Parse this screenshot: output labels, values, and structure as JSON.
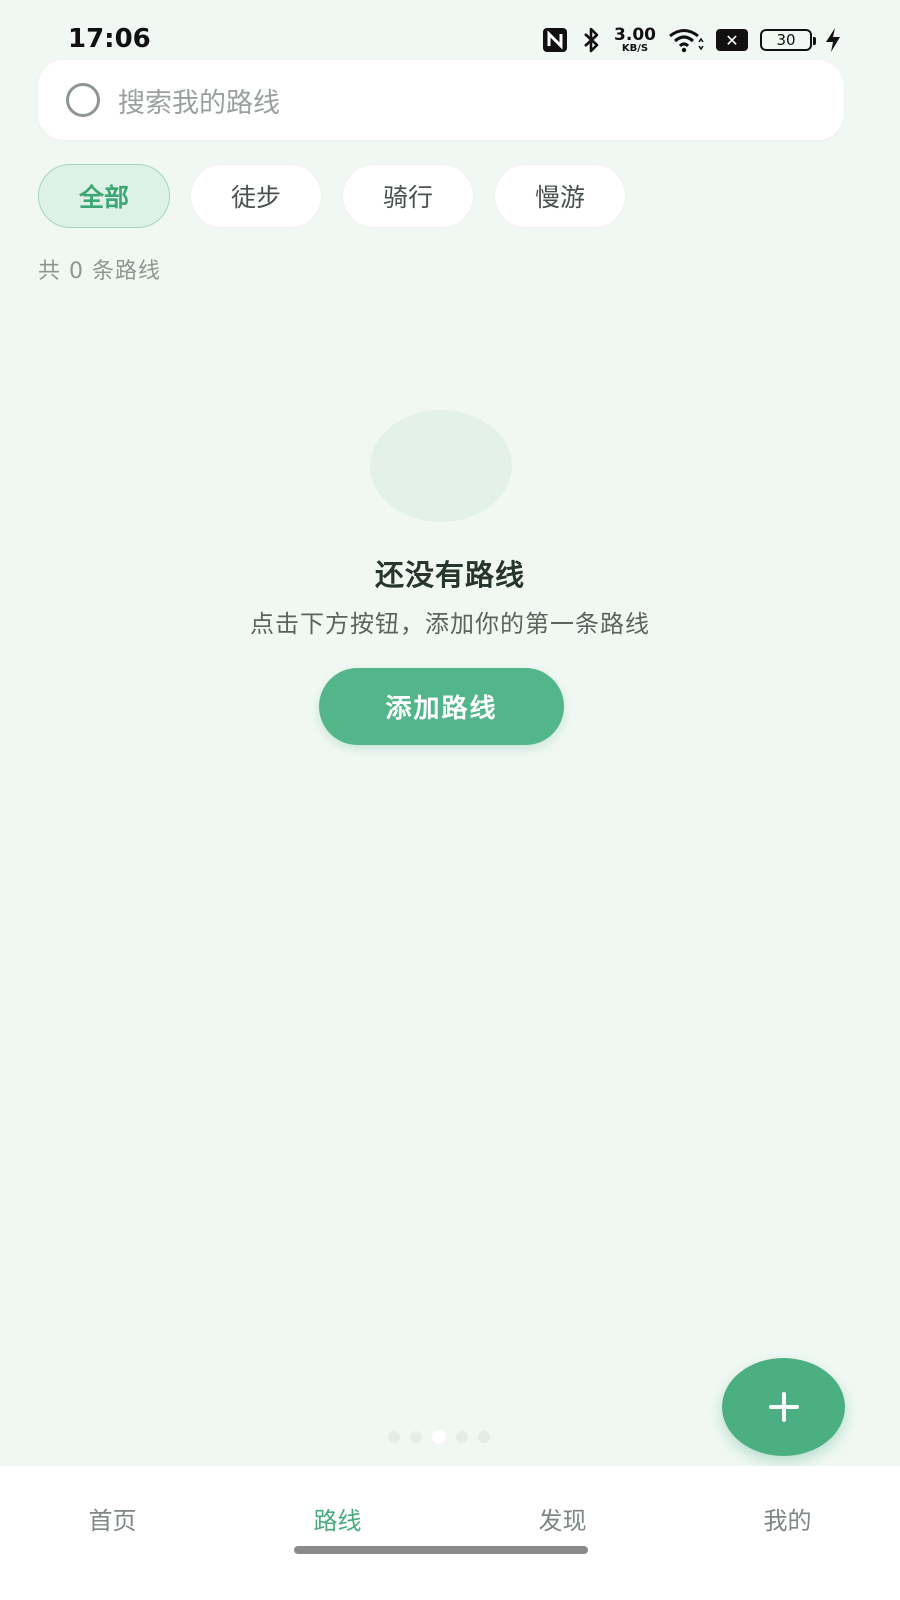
{
  "status_bar": {
    "time": "17:06",
    "net_speed_value": "3.00",
    "net_speed_unit": "KB/S",
    "battery_level": "30",
    "icons": [
      "nfc-icon",
      "bluetooth-icon",
      "wifi-icon",
      "sim-off-icon",
      "battery-icon",
      "charging-bolt-icon"
    ]
  },
  "search": {
    "placeholder": "搜索我的路线"
  },
  "filters": {
    "items": [
      "全部",
      "徒步",
      "骑行",
      "慢游"
    ],
    "selected": "全部"
  },
  "route_count_text": "共 0 条路线",
  "empty_state": {
    "title": "还没有路线",
    "subtitle": "点击下方按钮，添加你的第一条路线",
    "button_label": "添加路线"
  },
  "fab": {
    "icon": "plus-icon",
    "symbol": "+"
  },
  "bottom_nav": {
    "items": [
      "首页",
      "路线",
      "发现",
      "我的"
    ],
    "active": "路线"
  },
  "colors": {
    "accent": "#52b68a",
    "background": "#f1f8f4",
    "chip_active_bg": "#ddf1e6",
    "nav_active": "#47ab7c"
  }
}
